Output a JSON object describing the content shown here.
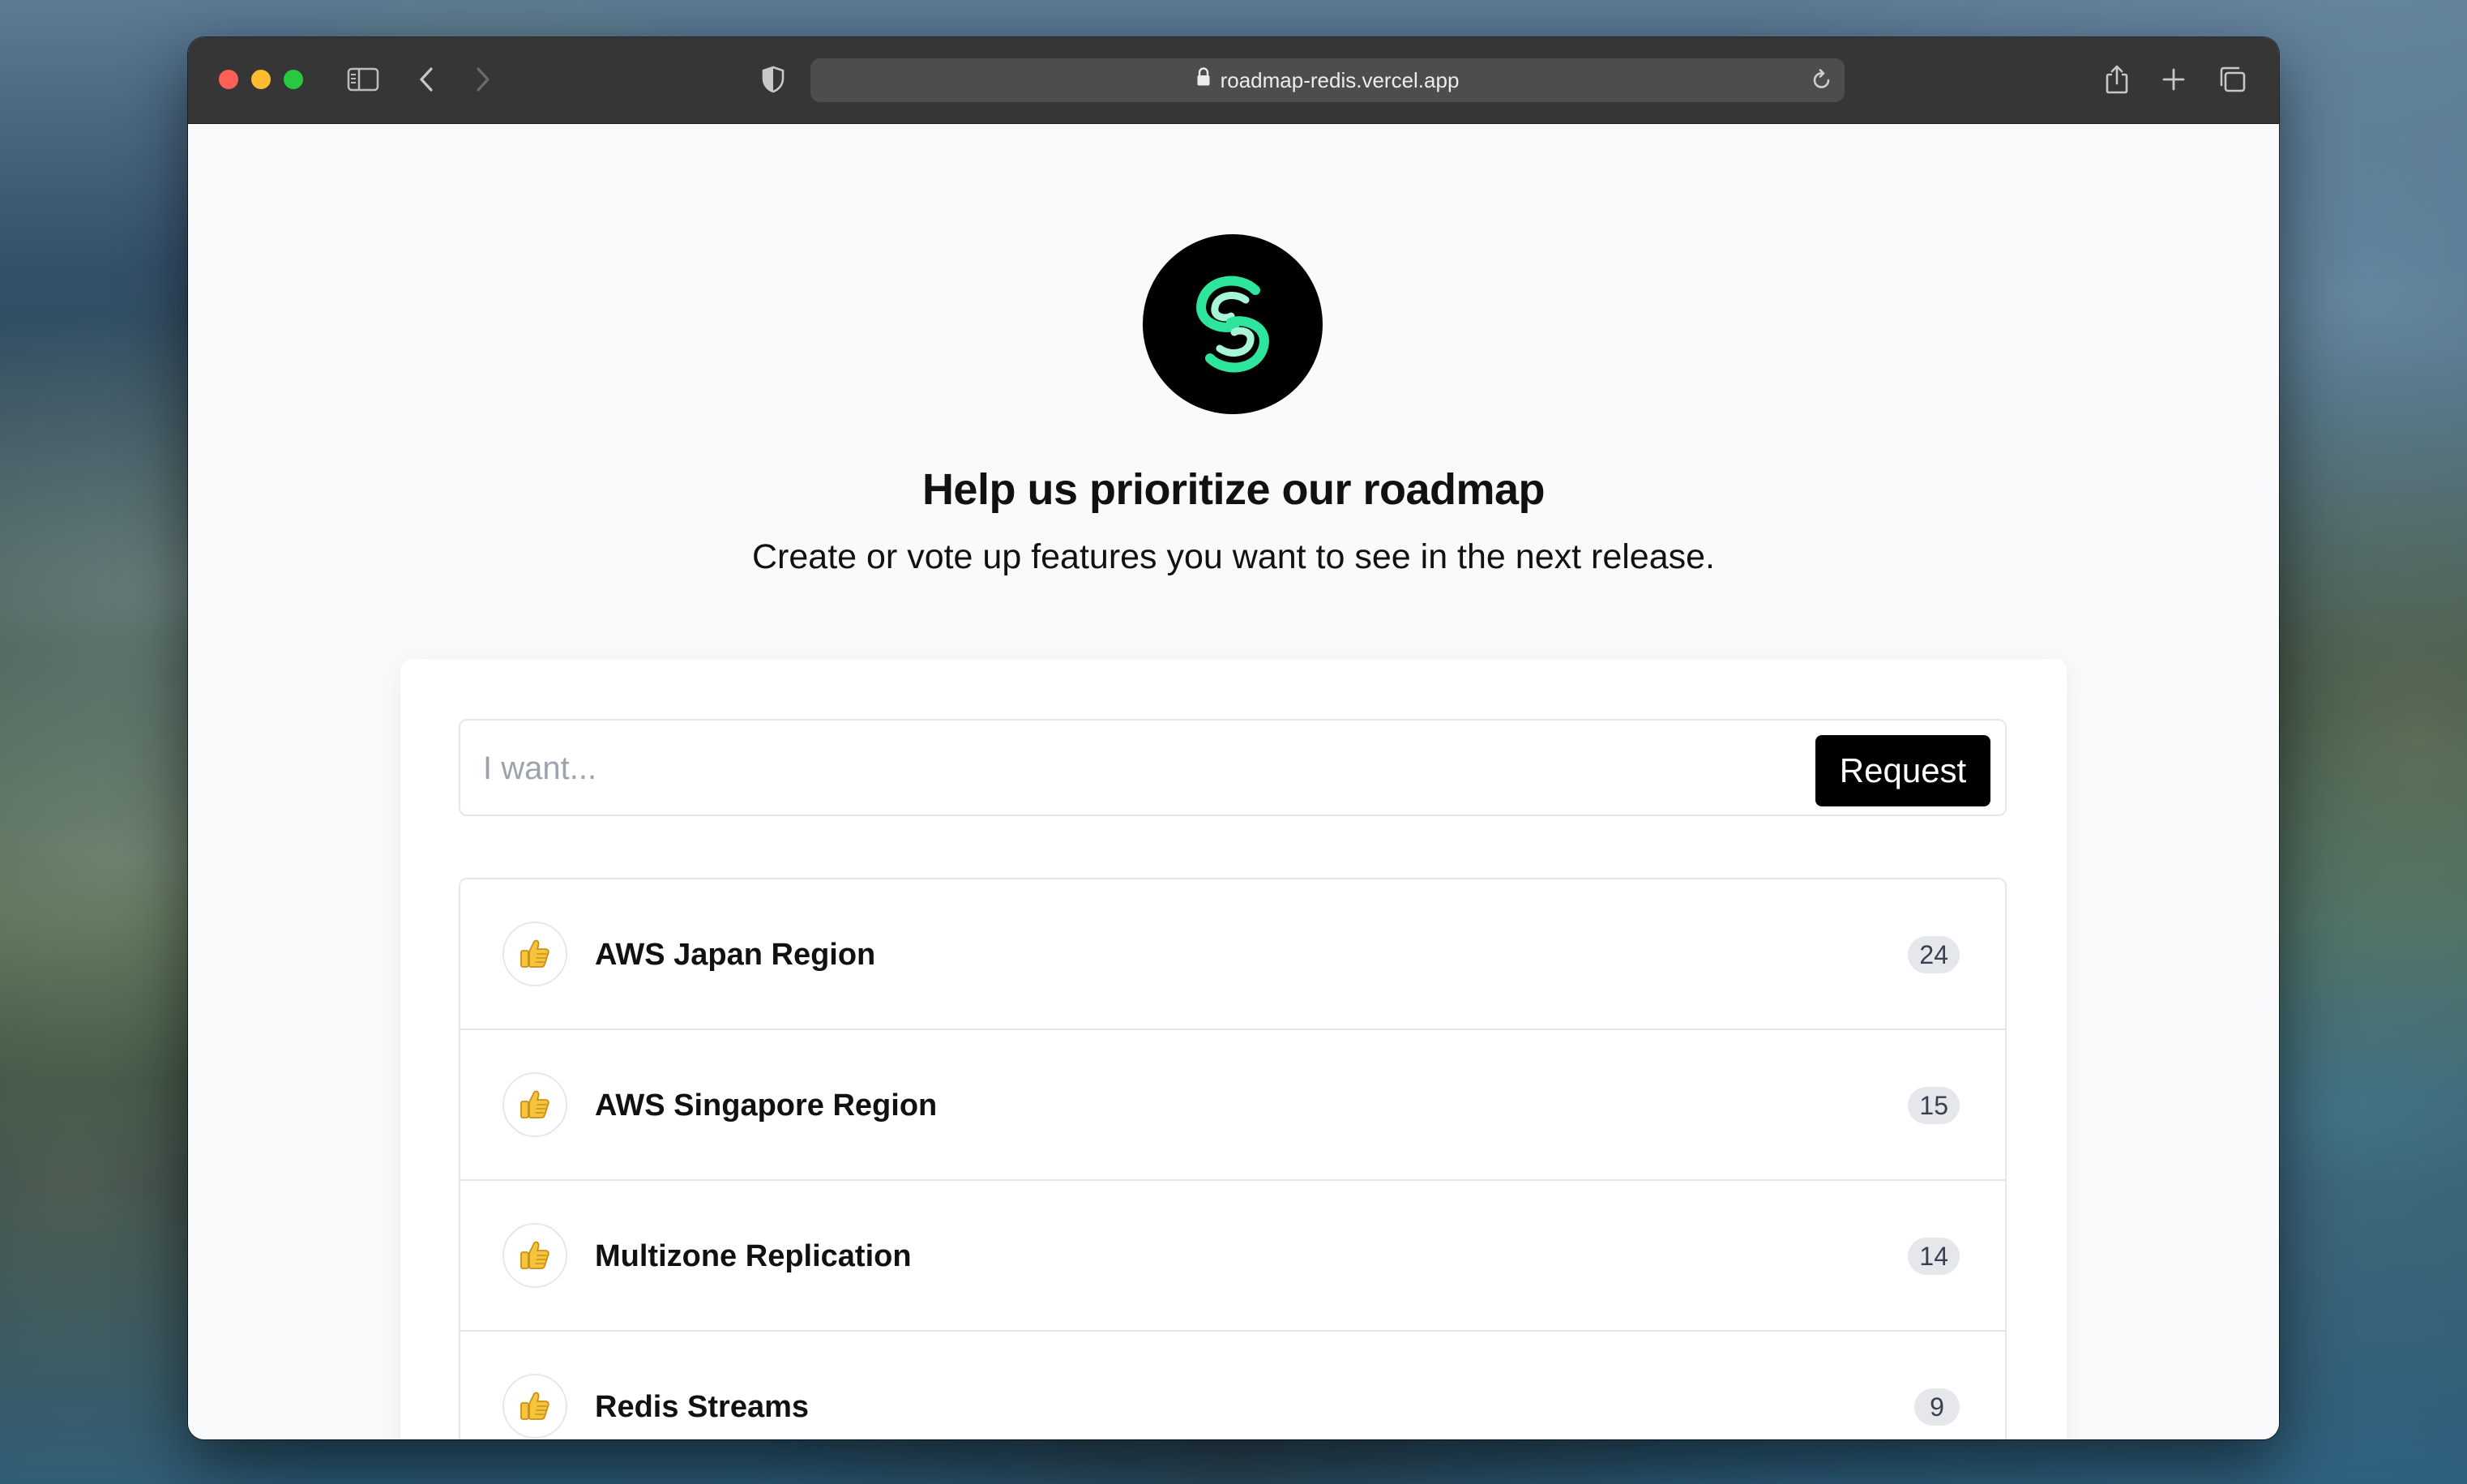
{
  "browser": {
    "url": "roadmap-redis.vercel.app",
    "icons": [
      "sidebar-toggle-icon",
      "back-icon",
      "forward-icon",
      "privacy-shield-icon",
      "lock-icon",
      "reload-icon",
      "share-icon",
      "new-tab-icon",
      "tab-overview-icon"
    ]
  },
  "page": {
    "logo_icon": "roadmap-logo-icon",
    "heading": "Help us prioritize our roadmap",
    "subheading": "Create or vote up features you want to see in the next release."
  },
  "request_form": {
    "placeholder": "I want...",
    "value": "",
    "button_label": "Request"
  },
  "features": [
    {
      "title": "AWS Japan Region",
      "votes": "24",
      "icon": "thumbs-up-icon"
    },
    {
      "title": "AWS Singapore Region",
      "votes": "15",
      "icon": "thumbs-up-icon"
    },
    {
      "title": "Multizone Replication",
      "votes": "14",
      "icon": "thumbs-up-icon"
    },
    {
      "title": "Redis Streams",
      "votes": "9",
      "icon": "thumbs-up-icon"
    }
  ],
  "colors": {
    "logo_accent": "#2ee59d",
    "button_bg": "#000000",
    "page_bg": "#f9fafb"
  }
}
